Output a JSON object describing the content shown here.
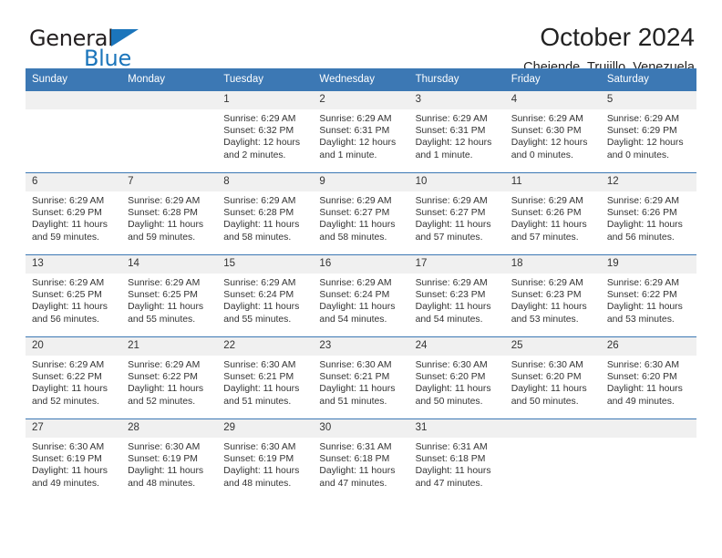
{
  "brand": {
    "name_top": "General",
    "name_bottom": "Blue",
    "triangle_icon": "blue-triangle-icon",
    "accent_color": "#1b75bb"
  },
  "header": {
    "title": "October 2024",
    "subtitle": "Chejende, Trujillo, Venezuela"
  },
  "theme": {
    "header_row_bg": "#3c78b4",
    "daynum_bg": "#f0f0f0",
    "grid_line": "#3c78b4",
    "text": "#333333"
  },
  "weekdays": [
    "Sunday",
    "Monday",
    "Tuesday",
    "Wednesday",
    "Thursday",
    "Friday",
    "Saturday"
  ],
  "weeks": [
    [
      {
        "day": "",
        "sunrise": "",
        "sunset": "",
        "daylight_1": "",
        "daylight_2": ""
      },
      {
        "day": "",
        "sunrise": "",
        "sunset": "",
        "daylight_1": "",
        "daylight_2": ""
      },
      {
        "day": "1",
        "sunrise": "Sunrise: 6:29 AM",
        "sunset": "Sunset: 6:32 PM",
        "daylight_1": "Daylight: 12 hours",
        "daylight_2": "and 2 minutes."
      },
      {
        "day": "2",
        "sunrise": "Sunrise: 6:29 AM",
        "sunset": "Sunset: 6:31 PM",
        "daylight_1": "Daylight: 12 hours",
        "daylight_2": "and 1 minute."
      },
      {
        "day": "3",
        "sunrise": "Sunrise: 6:29 AM",
        "sunset": "Sunset: 6:31 PM",
        "daylight_1": "Daylight: 12 hours",
        "daylight_2": "and 1 minute."
      },
      {
        "day": "4",
        "sunrise": "Sunrise: 6:29 AM",
        "sunset": "Sunset: 6:30 PM",
        "daylight_1": "Daylight: 12 hours",
        "daylight_2": "and 0 minutes."
      },
      {
        "day": "5",
        "sunrise": "Sunrise: 6:29 AM",
        "sunset": "Sunset: 6:29 PM",
        "daylight_1": "Daylight: 12 hours",
        "daylight_2": "and 0 minutes."
      }
    ],
    [
      {
        "day": "6",
        "sunrise": "Sunrise: 6:29 AM",
        "sunset": "Sunset: 6:29 PM",
        "daylight_1": "Daylight: 11 hours",
        "daylight_2": "and 59 minutes."
      },
      {
        "day": "7",
        "sunrise": "Sunrise: 6:29 AM",
        "sunset": "Sunset: 6:28 PM",
        "daylight_1": "Daylight: 11 hours",
        "daylight_2": "and 59 minutes."
      },
      {
        "day": "8",
        "sunrise": "Sunrise: 6:29 AM",
        "sunset": "Sunset: 6:28 PM",
        "daylight_1": "Daylight: 11 hours",
        "daylight_2": "and 58 minutes."
      },
      {
        "day": "9",
        "sunrise": "Sunrise: 6:29 AM",
        "sunset": "Sunset: 6:27 PM",
        "daylight_1": "Daylight: 11 hours",
        "daylight_2": "and 58 minutes."
      },
      {
        "day": "10",
        "sunrise": "Sunrise: 6:29 AM",
        "sunset": "Sunset: 6:27 PM",
        "daylight_1": "Daylight: 11 hours",
        "daylight_2": "and 57 minutes."
      },
      {
        "day": "11",
        "sunrise": "Sunrise: 6:29 AM",
        "sunset": "Sunset: 6:26 PM",
        "daylight_1": "Daylight: 11 hours",
        "daylight_2": "and 57 minutes."
      },
      {
        "day": "12",
        "sunrise": "Sunrise: 6:29 AM",
        "sunset": "Sunset: 6:26 PM",
        "daylight_1": "Daylight: 11 hours",
        "daylight_2": "and 56 minutes."
      }
    ],
    [
      {
        "day": "13",
        "sunrise": "Sunrise: 6:29 AM",
        "sunset": "Sunset: 6:25 PM",
        "daylight_1": "Daylight: 11 hours",
        "daylight_2": "and 56 minutes."
      },
      {
        "day": "14",
        "sunrise": "Sunrise: 6:29 AM",
        "sunset": "Sunset: 6:25 PM",
        "daylight_1": "Daylight: 11 hours",
        "daylight_2": "and 55 minutes."
      },
      {
        "day": "15",
        "sunrise": "Sunrise: 6:29 AM",
        "sunset": "Sunset: 6:24 PM",
        "daylight_1": "Daylight: 11 hours",
        "daylight_2": "and 55 minutes."
      },
      {
        "day": "16",
        "sunrise": "Sunrise: 6:29 AM",
        "sunset": "Sunset: 6:24 PM",
        "daylight_1": "Daylight: 11 hours",
        "daylight_2": "and 54 minutes."
      },
      {
        "day": "17",
        "sunrise": "Sunrise: 6:29 AM",
        "sunset": "Sunset: 6:23 PM",
        "daylight_1": "Daylight: 11 hours",
        "daylight_2": "and 54 minutes."
      },
      {
        "day": "18",
        "sunrise": "Sunrise: 6:29 AM",
        "sunset": "Sunset: 6:23 PM",
        "daylight_1": "Daylight: 11 hours",
        "daylight_2": "and 53 minutes."
      },
      {
        "day": "19",
        "sunrise": "Sunrise: 6:29 AM",
        "sunset": "Sunset: 6:22 PM",
        "daylight_1": "Daylight: 11 hours",
        "daylight_2": "and 53 minutes."
      }
    ],
    [
      {
        "day": "20",
        "sunrise": "Sunrise: 6:29 AM",
        "sunset": "Sunset: 6:22 PM",
        "daylight_1": "Daylight: 11 hours",
        "daylight_2": "and 52 minutes."
      },
      {
        "day": "21",
        "sunrise": "Sunrise: 6:29 AM",
        "sunset": "Sunset: 6:22 PM",
        "daylight_1": "Daylight: 11 hours",
        "daylight_2": "and 52 minutes."
      },
      {
        "day": "22",
        "sunrise": "Sunrise: 6:30 AM",
        "sunset": "Sunset: 6:21 PM",
        "daylight_1": "Daylight: 11 hours",
        "daylight_2": "and 51 minutes."
      },
      {
        "day": "23",
        "sunrise": "Sunrise: 6:30 AM",
        "sunset": "Sunset: 6:21 PM",
        "daylight_1": "Daylight: 11 hours",
        "daylight_2": "and 51 minutes."
      },
      {
        "day": "24",
        "sunrise": "Sunrise: 6:30 AM",
        "sunset": "Sunset: 6:20 PM",
        "daylight_1": "Daylight: 11 hours",
        "daylight_2": "and 50 minutes."
      },
      {
        "day": "25",
        "sunrise": "Sunrise: 6:30 AM",
        "sunset": "Sunset: 6:20 PM",
        "daylight_1": "Daylight: 11 hours",
        "daylight_2": "and 50 minutes."
      },
      {
        "day": "26",
        "sunrise": "Sunrise: 6:30 AM",
        "sunset": "Sunset: 6:20 PM",
        "daylight_1": "Daylight: 11 hours",
        "daylight_2": "and 49 minutes."
      }
    ],
    [
      {
        "day": "27",
        "sunrise": "Sunrise: 6:30 AM",
        "sunset": "Sunset: 6:19 PM",
        "daylight_1": "Daylight: 11 hours",
        "daylight_2": "and 49 minutes."
      },
      {
        "day": "28",
        "sunrise": "Sunrise: 6:30 AM",
        "sunset": "Sunset: 6:19 PM",
        "daylight_1": "Daylight: 11 hours",
        "daylight_2": "and 48 minutes."
      },
      {
        "day": "29",
        "sunrise": "Sunrise: 6:30 AM",
        "sunset": "Sunset: 6:19 PM",
        "daylight_1": "Daylight: 11 hours",
        "daylight_2": "and 48 minutes."
      },
      {
        "day": "30",
        "sunrise": "Sunrise: 6:31 AM",
        "sunset": "Sunset: 6:18 PM",
        "daylight_1": "Daylight: 11 hours",
        "daylight_2": "and 47 minutes."
      },
      {
        "day": "31",
        "sunrise": "Sunrise: 6:31 AM",
        "sunset": "Sunset: 6:18 PM",
        "daylight_1": "Daylight: 11 hours",
        "daylight_2": "and 47 minutes."
      },
      {
        "day": "",
        "sunrise": "",
        "sunset": "",
        "daylight_1": "",
        "daylight_2": ""
      },
      {
        "day": "",
        "sunrise": "",
        "sunset": "",
        "daylight_1": "",
        "daylight_2": ""
      }
    ]
  ]
}
